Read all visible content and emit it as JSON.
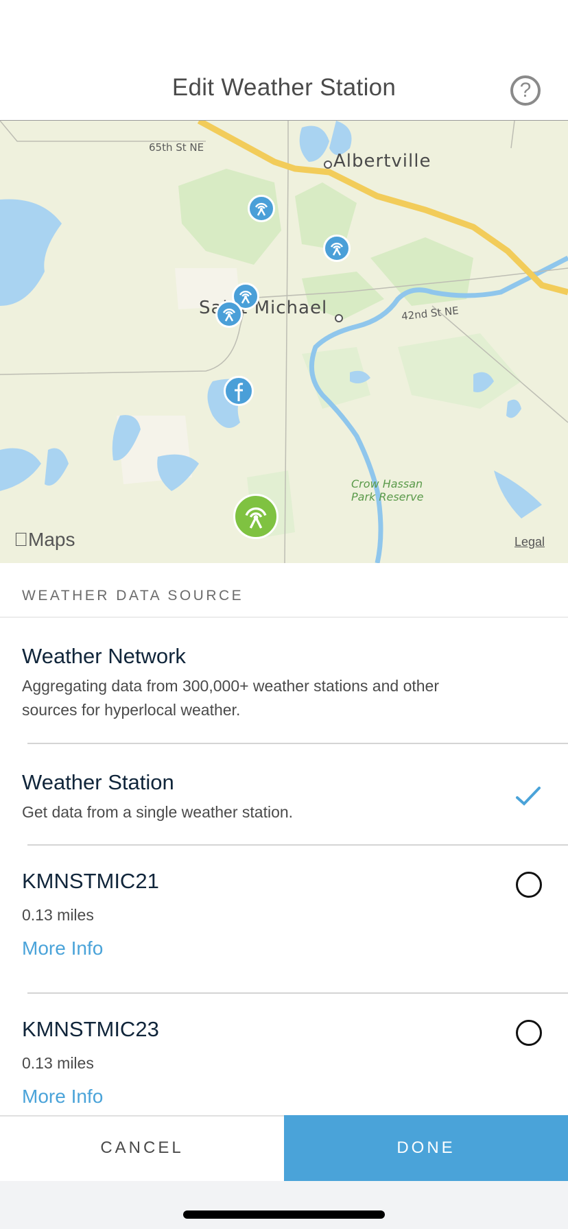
{
  "header": {
    "title": "Edit Weather Station",
    "help_icon": "question-circle-icon",
    "help_glyph": "?"
  },
  "map": {
    "labels": {
      "road_65th": "65th St NE",
      "road_42nd": "42nd St NE",
      "city_albertville": "Albertville",
      "city_saint_michael": "Saint Michael",
      "park_line1": "Crow Hassan",
      "park_line2": "Park Reserve"
    },
    "attribution": "Maps",
    "legal": "Legal",
    "pins": [
      {
        "type": "weather-station",
        "color": "#4a9fd8",
        "selected": false
      },
      {
        "type": "weather-station",
        "color": "#4a9fd8",
        "selected": false
      },
      {
        "type": "weather-station",
        "color": "#4a9fd8",
        "selected": false
      },
      {
        "type": "weather-station",
        "color": "#4a9fd8",
        "selected": false
      },
      {
        "type": "weather-station-cluster",
        "color": "#4a9fd8",
        "selected": false
      },
      {
        "type": "weather-station",
        "color": "#7fc241",
        "selected": true
      }
    ]
  },
  "section": {
    "title": "WEATHER DATA SOURCE"
  },
  "options": [
    {
      "title": "Weather Network",
      "description": "Aggregating data from 300,000+ weather stations and other sources for hyperlocal weather.",
      "selected": false
    },
    {
      "title": "Weather Station",
      "description": "Get data from a single weather station.",
      "selected": true
    }
  ],
  "stations": [
    {
      "id": "KMNSTMIC21",
      "distance": "0.13 miles",
      "link": "More Info",
      "selected": false
    },
    {
      "id": "KMNSTMIC23",
      "distance": "0.13 miles",
      "link": "More Info",
      "selected": false
    }
  ],
  "footer": {
    "cancel_label": "CANCEL",
    "done_label": "DONE"
  },
  "colors": {
    "accent": "#4aa3d9",
    "selected_pin": "#7fc241",
    "station_pin": "#4a9fd8"
  }
}
